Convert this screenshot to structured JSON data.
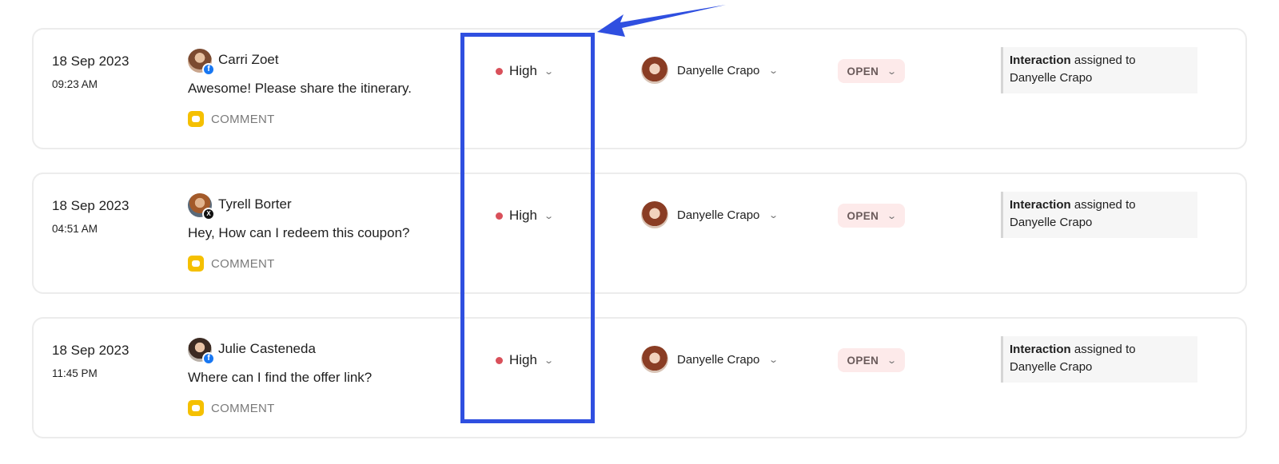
{
  "rows": [
    {
      "date": "18 Sep 2023",
      "time": "09:23 AM",
      "customer_name": "Carri Zoet",
      "customer_network_icon": "facebook-icon",
      "message": "Awesome! Please share the itinerary.",
      "type_label": "COMMENT",
      "priority": "High",
      "assignee": "Danyelle Crapo",
      "status": "OPEN",
      "activity_bold": "Interaction",
      "activity_text": "assigned to",
      "activity_assignee": "Danyelle Crapo"
    },
    {
      "date": "18 Sep 2023",
      "time": "04:51 AM",
      "customer_name": "Tyrell Borter",
      "customer_network_icon": "x-icon",
      "message": "Hey, How can I redeem this coupon?",
      "type_label": "COMMENT",
      "priority": "High",
      "assignee": "Danyelle Crapo",
      "status": "OPEN",
      "activity_bold": "Interaction",
      "activity_text": "assigned to",
      "activity_assignee": "Danyelle Crapo"
    },
    {
      "date": "18 Sep 2023",
      "time": "11:45 PM",
      "customer_name": "Julie Casteneda",
      "customer_network_icon": "facebook-icon",
      "message": "Where can I find the offer link?",
      "type_label": "COMMENT",
      "priority": "High",
      "assignee": "Danyelle Crapo",
      "status": "OPEN",
      "activity_bold": "Interaction",
      "activity_text": "assigned to",
      "activity_assignee": "Danyelle Crapo"
    }
  ],
  "colors": {
    "priority_high": "#d9505a",
    "highlight": "#2f4fe0",
    "comment_icon": "#f5c000",
    "status_bg": "#fdeaea"
  }
}
